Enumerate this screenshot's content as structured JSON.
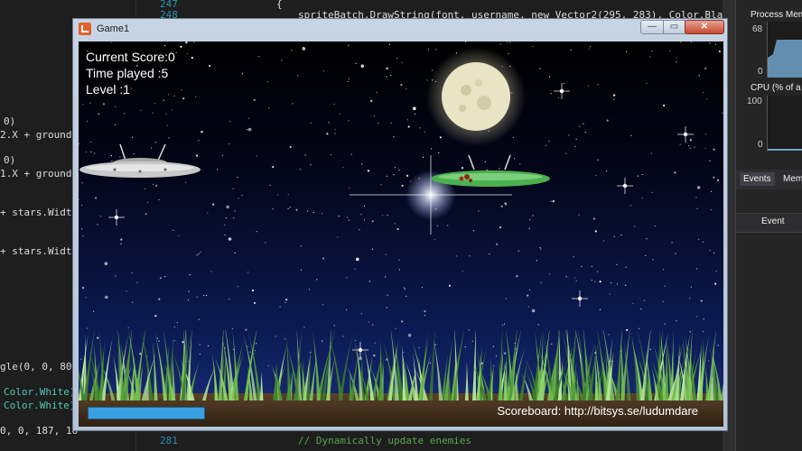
{
  "ide": {
    "line_numbers": [
      "247",
      "248",
      "281"
    ],
    "code_lines": [
      "{",
      "spriteBatch.DrawString(font, username, new Vector2(295, 283), Color.Black);",
      "// Dynamically update enemies"
    ],
    "left_fragments": [
      "0)",
      "2.X + ground.",
      "0)",
      "1.X + ground.",
      "+ stars.Width",
      "+ stars.Width",
      "gle(0, 0, 800",
      "Color.White)",
      "Color.White)",
      "0, 0, 187, 16"
    ],
    "diagnostics": {
      "memory_title": "Process Mem",
      "memory_value": "68",
      "memory_zero": "0",
      "cpu_title": "CPU (% of a",
      "cpu_value": "100",
      "cpu_zero": "0",
      "tab_events": "Events",
      "tab_memory": "Mem",
      "events_header": "Event"
    }
  },
  "window": {
    "title": "Game1",
    "minimize_glyph": "—",
    "maximize_glyph": "▭",
    "close_glyph": "✕"
  },
  "game": {
    "score_label": "Current Score:0",
    "time_label": "Time played :5",
    "level_label": "Level :1",
    "scoreboard": "Scoreboard: http://bitsys.se/ludumdare",
    "health_fraction": 1.0
  },
  "colors": {
    "sky_top": "#000000",
    "sky_bottom": "#1b2f7a",
    "grass": "#6fbf4a",
    "dirt": "#4b3522",
    "moon": "#e9e4c3",
    "ufo_silver": "#c9c9c9",
    "ufo_green": "#4caf50"
  }
}
